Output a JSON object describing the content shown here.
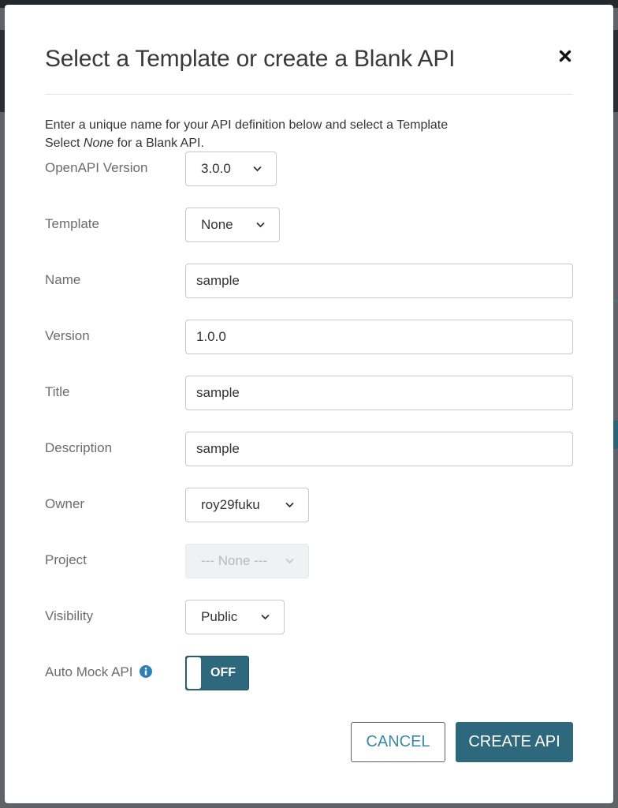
{
  "dialog": {
    "title": "Select a Template or create a Blank API",
    "intro_line1": "Enter a unique name for your API definition below and select a Template",
    "intro_line2_prefix": "Select ",
    "intro_line2_italic": "None",
    "intro_line2_suffix": " for a Blank API.",
    "close_icon": "close-icon"
  },
  "form": {
    "openapi_version": {
      "label": "OpenAPI Version",
      "value": "3.0.0"
    },
    "template": {
      "label": "Template",
      "value": "None"
    },
    "name": {
      "label": "Name",
      "value": "sample"
    },
    "version": {
      "label": "Version",
      "value": "1.0.0"
    },
    "title": {
      "label": "Title",
      "value": "sample"
    },
    "description": {
      "label": "Description",
      "value": "sample"
    },
    "owner": {
      "label": "Owner",
      "value": "roy29fuku"
    },
    "project": {
      "label": "Project",
      "value": "--- None ---",
      "disabled": true
    },
    "visibility": {
      "label": "Visibility",
      "value": "Public"
    },
    "auto_mock": {
      "label": "Auto Mock API",
      "state": "OFF",
      "info_icon": "info-icon"
    }
  },
  "actions": {
    "cancel_label": "CANCEL",
    "create_label": "CREATE API"
  },
  "colors": {
    "accent": "#2d687d",
    "cancel_text": "#3b8aa3",
    "label_text": "#6c6c6c"
  }
}
